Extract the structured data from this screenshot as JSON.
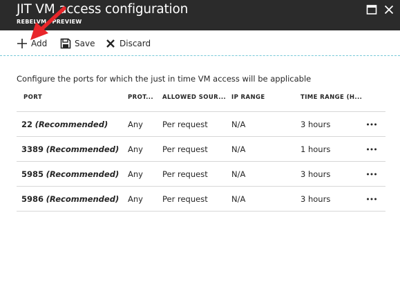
{
  "window": {
    "title": "JIT VM access configuration",
    "subtitle": "REBELVM",
    "subtitle_suffix": "PREVIEW"
  },
  "toolbar": {
    "add_label": "Add",
    "save_label": "Save",
    "discard_label": "Discard"
  },
  "description": "Configure the ports for which the just in time VM access will be applicable",
  "table": {
    "columns": [
      "PORT",
      "PROT...",
      "ALLOWED SOUR...",
      "IP RANGE",
      "TIME RANGE (H..."
    ],
    "rows": [
      {
        "port": "22",
        "tag": "(Recommended)",
        "protocol": "Any",
        "source": "Per request",
        "ip_range": "N/A",
        "time_range": "3 hours"
      },
      {
        "port": "3389",
        "tag": "(Recommended)",
        "protocol": "Any",
        "source": "Per request",
        "ip_range": "N/A",
        "time_range": "1 hours"
      },
      {
        "port": "5985",
        "tag": "(Recommended)",
        "protocol": "Any",
        "source": "Per request",
        "ip_range": "N/A",
        "time_range": "3 hours"
      },
      {
        "port": "5986",
        "tag": "(Recommended)",
        "protocol": "Any",
        "source": "Per request",
        "ip_range": "N/A",
        "time_range": "3 hours"
      }
    ]
  },
  "colors": {
    "titlebar": "#2b2b2b",
    "annotation_arrow": "#e8262a",
    "toolbar_divider": "#74c8d8"
  },
  "icons": {
    "add": "plus-icon",
    "save": "floppy-disk-icon",
    "discard": "x-icon",
    "maximize": "maximize-icon",
    "close": "close-icon",
    "row_menu": "more-ellipsis-icon"
  }
}
